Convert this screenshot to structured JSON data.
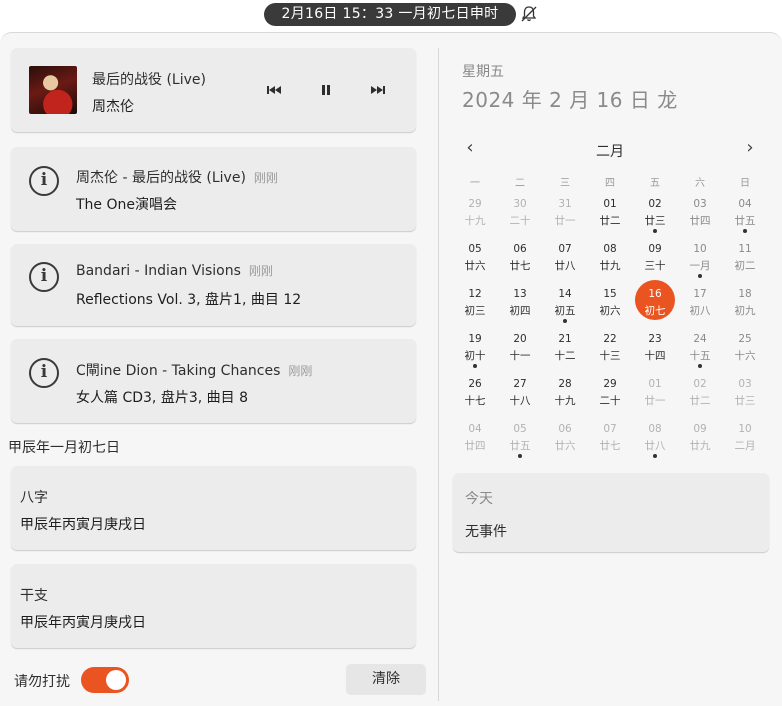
{
  "topbar": {
    "clock": "2月16日  15：33   一月初七日申时",
    "bell_icon": "bell-muted-icon"
  },
  "notifications": {
    "media": {
      "title": "最后的战役 (Live)",
      "artist": "周杰伦",
      "controls": [
        "previous-icon",
        "pause-icon",
        "next-icon"
      ]
    },
    "items": [
      {
        "title": "周杰伦 - 最后的战役 (Live)",
        "time": "刚刚",
        "body": "The One演唱会"
      },
      {
        "title": "Bandari - Indian Visions",
        "time": "刚刚",
        "body": "Reflections Vol. 3, 盘片1, 曲目 12"
      },
      {
        "title": "C閘ine Dion - Taking Chances",
        "time": "刚刚",
        "body": "女人篇 CD3, 盘片3, 曲目 8"
      }
    ],
    "lunar_section": "甲辰年一月初七日",
    "lunar_cards": [
      {
        "title": "八字",
        "body": "甲辰年丙寅月庚戌日"
      },
      {
        "title": "干支",
        "body": "甲辰年丙寅月庚戌日"
      }
    ],
    "dnd_label": "请勿打扰",
    "dnd_on": true,
    "clear_label": "清除"
  },
  "calendar": {
    "weekday": "星期五",
    "full_date": "2024 年 2 月 16 日   龙",
    "month": "二月",
    "prev_icon": "chevron-left-icon",
    "next_icon": "chevron-right-icon",
    "weekdays": [
      "一",
      "二",
      "三",
      "四",
      "五",
      "六",
      "日"
    ],
    "weeks": [
      [
        {
          "d": "29",
          "l": "十九",
          "o": true
        },
        {
          "d": "30",
          "l": "二十",
          "o": true
        },
        {
          "d": "31",
          "l": "廿一",
          "o": true
        },
        {
          "d": "01",
          "l": "廿二"
        },
        {
          "d": "02",
          "l": "廿三",
          "dot": true
        },
        {
          "d": "03",
          "l": "廿四",
          "w": true
        },
        {
          "d": "04",
          "l": "廿五",
          "w": true,
          "dot": true
        }
      ],
      [
        {
          "d": "05",
          "l": "廿六"
        },
        {
          "d": "06",
          "l": "廿七"
        },
        {
          "d": "07",
          "l": "廿八"
        },
        {
          "d": "08",
          "l": "廿九"
        },
        {
          "d": "09",
          "l": "三十"
        },
        {
          "d": "10",
          "l": "一月",
          "w": true,
          "dot": true
        },
        {
          "d": "11",
          "l": "初二",
          "w": true
        }
      ],
      [
        {
          "d": "12",
          "l": "初三"
        },
        {
          "d": "13",
          "l": "初四"
        },
        {
          "d": "14",
          "l": "初五",
          "dot": true
        },
        {
          "d": "15",
          "l": "初六"
        },
        {
          "d": "16",
          "l": "初七",
          "today": true
        },
        {
          "d": "17",
          "l": "初八",
          "w": true
        },
        {
          "d": "18",
          "l": "初九",
          "w": true
        }
      ],
      [
        {
          "d": "19",
          "l": "初十",
          "dot": true
        },
        {
          "d": "20",
          "l": "十一"
        },
        {
          "d": "21",
          "l": "十二"
        },
        {
          "d": "22",
          "l": "十三"
        },
        {
          "d": "23",
          "l": "十四"
        },
        {
          "d": "24",
          "l": "十五",
          "w": true,
          "dot": true
        },
        {
          "d": "25",
          "l": "十六",
          "w": true
        }
      ],
      [
        {
          "d": "26",
          "l": "十七"
        },
        {
          "d": "27",
          "l": "十八"
        },
        {
          "d": "28",
          "l": "十九"
        },
        {
          "d": "29",
          "l": "二十"
        },
        {
          "d": "01",
          "l": "廿一",
          "o": true
        },
        {
          "d": "02",
          "l": "廿二",
          "o": true
        },
        {
          "d": "03",
          "l": "廿三",
          "o": true
        }
      ],
      [
        {
          "d": "04",
          "l": "廿四",
          "o": true
        },
        {
          "d": "05",
          "l": "廿五",
          "o": true,
          "dot": true
        },
        {
          "d": "06",
          "l": "廿六",
          "o": true
        },
        {
          "d": "07",
          "l": "廿七",
          "o": true
        },
        {
          "d": "08",
          "l": "廿八",
          "o": true,
          "dot": true
        },
        {
          "d": "09",
          "l": "廿九",
          "o": true
        },
        {
          "d": "10",
          "l": "二月",
          "o": true
        }
      ]
    ],
    "events": {
      "title": "今天",
      "body": "无事件"
    }
  },
  "colors": {
    "accent": "#e95420",
    "panel": "#f6f6f6",
    "card": "#ececec"
  }
}
